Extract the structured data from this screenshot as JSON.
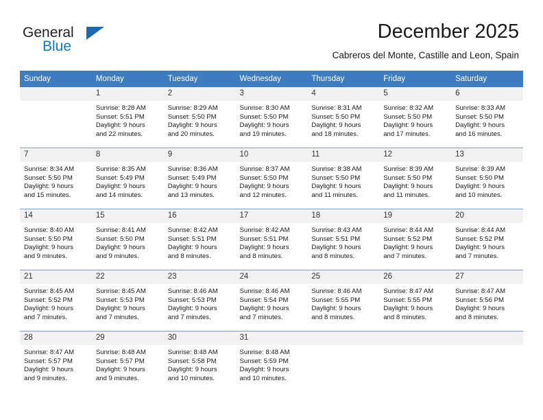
{
  "brand": {
    "name_part1": "General",
    "name_part2": "Blue",
    "accent_color": "#1278be",
    "triangle_color": "#1b69b0"
  },
  "header": {
    "month_title": "December 2025",
    "location": "Cabreros del Monte, Castille and Leon, Spain"
  },
  "calendar": {
    "header_bg": "#3c7cbf",
    "daynum_bg": "#f2f2f2",
    "weekday_headers": [
      "Sunday",
      "Monday",
      "Tuesday",
      "Wednesday",
      "Thursday",
      "Friday",
      "Saturday"
    ],
    "weeks": [
      [
        {
          "day": "",
          "lines": []
        },
        {
          "day": "1",
          "lines": [
            "Sunrise: 8:28 AM",
            "Sunset: 5:51 PM",
            "Daylight: 9 hours",
            "and 22 minutes."
          ]
        },
        {
          "day": "2",
          "lines": [
            "Sunrise: 8:29 AM",
            "Sunset: 5:50 PM",
            "Daylight: 9 hours",
            "and 20 minutes."
          ]
        },
        {
          "day": "3",
          "lines": [
            "Sunrise: 8:30 AM",
            "Sunset: 5:50 PM",
            "Daylight: 9 hours",
            "and 19 minutes."
          ]
        },
        {
          "day": "4",
          "lines": [
            "Sunrise: 8:31 AM",
            "Sunset: 5:50 PM",
            "Daylight: 9 hours",
            "and 18 minutes."
          ]
        },
        {
          "day": "5",
          "lines": [
            "Sunrise: 8:32 AM",
            "Sunset: 5:50 PM",
            "Daylight: 9 hours",
            "and 17 minutes."
          ]
        },
        {
          "day": "6",
          "lines": [
            "Sunrise: 8:33 AM",
            "Sunset: 5:50 PM",
            "Daylight: 9 hours",
            "and 16 minutes."
          ]
        }
      ],
      [
        {
          "day": "7",
          "lines": [
            "Sunrise: 8:34 AM",
            "Sunset: 5:50 PM",
            "Daylight: 9 hours",
            "and 15 minutes."
          ]
        },
        {
          "day": "8",
          "lines": [
            "Sunrise: 8:35 AM",
            "Sunset: 5:49 PM",
            "Daylight: 9 hours",
            "and 14 minutes."
          ]
        },
        {
          "day": "9",
          "lines": [
            "Sunrise: 8:36 AM",
            "Sunset: 5:49 PM",
            "Daylight: 9 hours",
            "and 13 minutes."
          ]
        },
        {
          "day": "10",
          "lines": [
            "Sunrise: 8:37 AM",
            "Sunset: 5:50 PM",
            "Daylight: 9 hours",
            "and 12 minutes."
          ]
        },
        {
          "day": "11",
          "lines": [
            "Sunrise: 8:38 AM",
            "Sunset: 5:50 PM",
            "Daylight: 9 hours",
            "and 11 minutes."
          ]
        },
        {
          "day": "12",
          "lines": [
            "Sunrise: 8:39 AM",
            "Sunset: 5:50 PM",
            "Daylight: 9 hours",
            "and 11 minutes."
          ]
        },
        {
          "day": "13",
          "lines": [
            "Sunrise: 8:39 AM",
            "Sunset: 5:50 PM",
            "Daylight: 9 hours",
            "and 10 minutes."
          ]
        }
      ],
      [
        {
          "day": "14",
          "lines": [
            "Sunrise: 8:40 AM",
            "Sunset: 5:50 PM",
            "Daylight: 9 hours",
            "and 9 minutes."
          ]
        },
        {
          "day": "15",
          "lines": [
            "Sunrise: 8:41 AM",
            "Sunset: 5:50 PM",
            "Daylight: 9 hours",
            "and 9 minutes."
          ]
        },
        {
          "day": "16",
          "lines": [
            "Sunrise: 8:42 AM",
            "Sunset: 5:51 PM",
            "Daylight: 9 hours",
            "and 8 minutes."
          ]
        },
        {
          "day": "17",
          "lines": [
            "Sunrise: 8:42 AM",
            "Sunset: 5:51 PM",
            "Daylight: 9 hours",
            "and 8 minutes."
          ]
        },
        {
          "day": "18",
          "lines": [
            "Sunrise: 8:43 AM",
            "Sunset: 5:51 PM",
            "Daylight: 9 hours",
            "and 8 minutes."
          ]
        },
        {
          "day": "19",
          "lines": [
            "Sunrise: 8:44 AM",
            "Sunset: 5:52 PM",
            "Daylight: 9 hours",
            "and 7 minutes."
          ]
        },
        {
          "day": "20",
          "lines": [
            "Sunrise: 8:44 AM",
            "Sunset: 5:52 PM",
            "Daylight: 9 hours",
            "and 7 minutes."
          ]
        }
      ],
      [
        {
          "day": "21",
          "lines": [
            "Sunrise: 8:45 AM",
            "Sunset: 5:52 PM",
            "Daylight: 9 hours",
            "and 7 minutes."
          ]
        },
        {
          "day": "22",
          "lines": [
            "Sunrise: 8:45 AM",
            "Sunset: 5:53 PM",
            "Daylight: 9 hours",
            "and 7 minutes."
          ]
        },
        {
          "day": "23",
          "lines": [
            "Sunrise: 8:46 AM",
            "Sunset: 5:53 PM",
            "Daylight: 9 hours",
            "and 7 minutes."
          ]
        },
        {
          "day": "24",
          "lines": [
            "Sunrise: 8:46 AM",
            "Sunset: 5:54 PM",
            "Daylight: 9 hours",
            "and 7 minutes."
          ]
        },
        {
          "day": "25",
          "lines": [
            "Sunrise: 8:46 AM",
            "Sunset: 5:55 PM",
            "Daylight: 9 hours",
            "and 8 minutes."
          ]
        },
        {
          "day": "26",
          "lines": [
            "Sunrise: 8:47 AM",
            "Sunset: 5:55 PM",
            "Daylight: 9 hours",
            "and 8 minutes."
          ]
        },
        {
          "day": "27",
          "lines": [
            "Sunrise: 8:47 AM",
            "Sunset: 5:56 PM",
            "Daylight: 9 hours",
            "and 8 minutes."
          ]
        }
      ],
      [
        {
          "day": "28",
          "lines": [
            "Sunrise: 8:47 AM",
            "Sunset: 5:57 PM",
            "Daylight: 9 hours",
            "and 9 minutes."
          ]
        },
        {
          "day": "29",
          "lines": [
            "Sunrise: 8:48 AM",
            "Sunset: 5:57 PM",
            "Daylight: 9 hours",
            "and 9 minutes."
          ]
        },
        {
          "day": "30",
          "lines": [
            "Sunrise: 8:48 AM",
            "Sunset: 5:58 PM",
            "Daylight: 9 hours",
            "and 10 minutes."
          ]
        },
        {
          "day": "31",
          "lines": [
            "Sunrise: 8:48 AM",
            "Sunset: 5:59 PM",
            "Daylight: 9 hours",
            "and 10 minutes."
          ]
        },
        {
          "day": "",
          "lines": []
        },
        {
          "day": "",
          "lines": []
        },
        {
          "day": "",
          "lines": []
        }
      ]
    ]
  }
}
